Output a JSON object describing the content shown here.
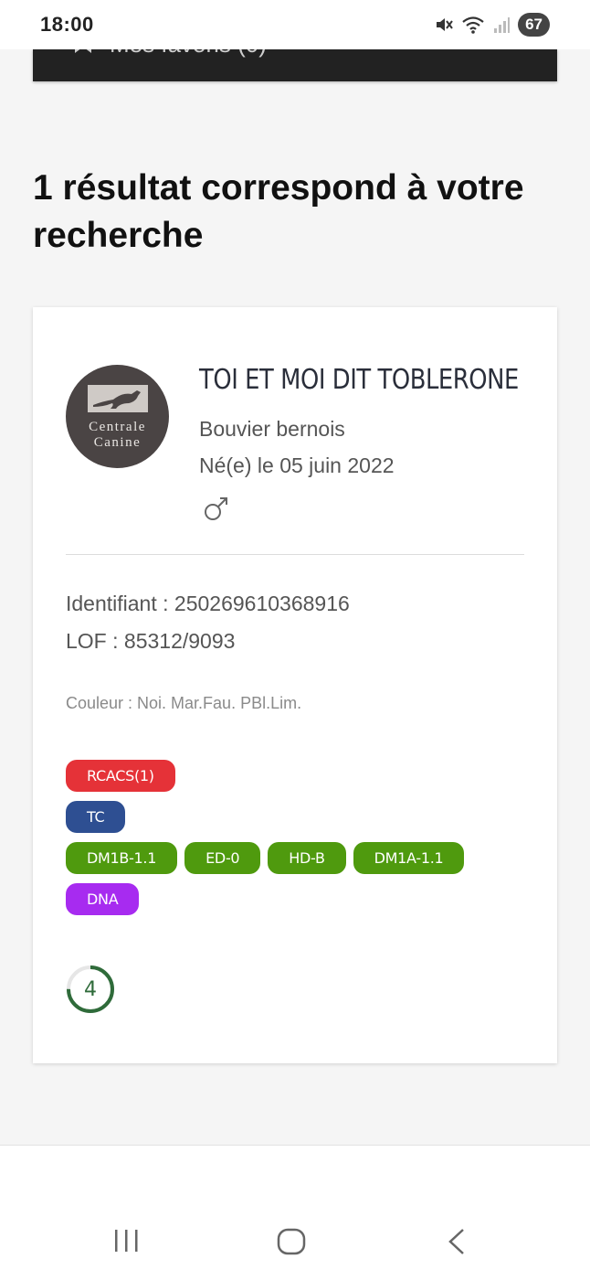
{
  "status_bar": {
    "time": "18:00",
    "battery": "67",
    "icons": [
      "mute-icon",
      "wifi-icon",
      "signal-icon"
    ]
  },
  "header_strip": {
    "label": "Mes favoris (0)",
    "icon": "bookmark-icon"
  },
  "result_heading": "1 résultat correspond à votre recherche",
  "result": {
    "logo_text_line1": "Centrale",
    "logo_text_line2": "Canine",
    "name": "TOI ET MOI DIT TOBLERONE",
    "breed": "Bouvier bernois",
    "birth": "Né(e) le 05 juin 2022",
    "gender_icon": "male-symbol-icon",
    "identifiant": "Identifiant : 250269610368916",
    "lof": "LOF : 85312/9093",
    "couleur": "Couleur : Noi. Mar.Fau. PBl.Lim.",
    "tags": [
      {
        "label": "RCACS(1)",
        "color": "#e53238"
      },
      {
        "label": "TC",
        "color": "#2e4f92"
      },
      {
        "label": "DM1B-1.1",
        "color": "#4f9a0e"
      },
      {
        "label": "ED-0",
        "color": "#4f9a0e"
      },
      {
        "label": "HD-B",
        "color": "#4f9a0e"
      },
      {
        "label": "DM1A-1.1",
        "color": "#4f9a0e"
      },
      {
        "label": "DNA",
        "color": "#a72bf0"
      }
    ],
    "score": "4",
    "score_fraction": 0.75
  },
  "nav": {
    "icons": [
      "recent-apps-icon",
      "home-icon",
      "back-icon"
    ]
  },
  "colors": {
    "background": "#f5f5f5",
    "card": "#ffffff",
    "score_ring": "#2f6b3a"
  }
}
